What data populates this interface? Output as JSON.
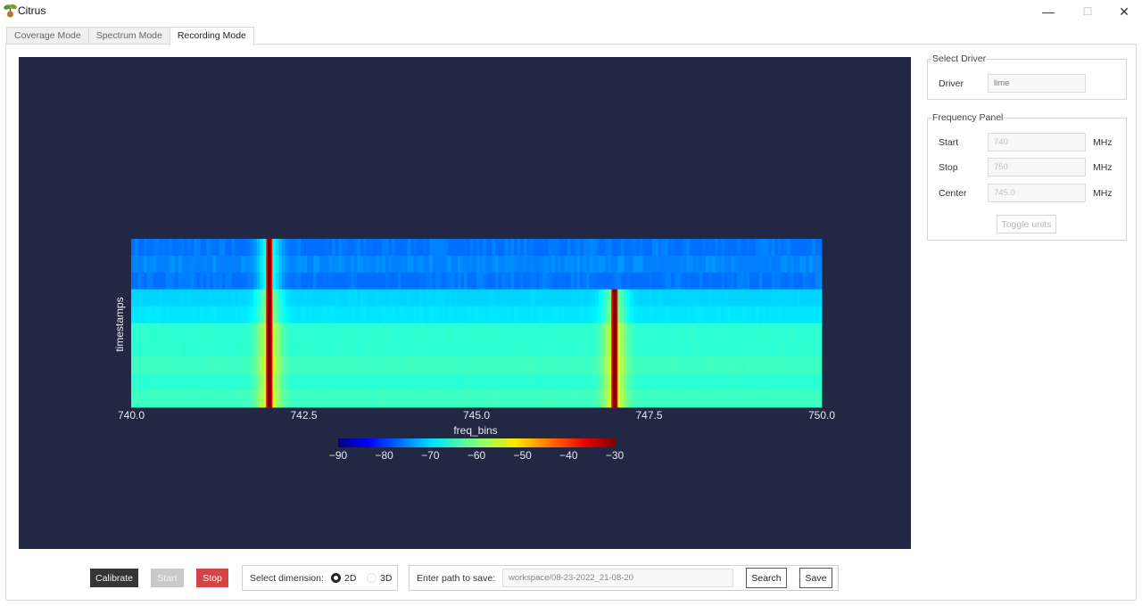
{
  "window": {
    "title": "Citrus",
    "controls": {
      "minimize": "—",
      "maximize": "☐",
      "close": "✕"
    }
  },
  "tabs": [
    {
      "label": "Coverage Mode",
      "active": false
    },
    {
      "label": "Spectrum Mode",
      "active": false
    },
    {
      "label": "Recording Mode",
      "active": true
    }
  ],
  "select_driver": {
    "title": "Select Driver",
    "driver_label": "Driver",
    "driver_value": "lime"
  },
  "frequency_panel": {
    "title": "Frequency Panel",
    "start_label": "Start",
    "start_value": "740",
    "stop_label": "Stop",
    "stop_value": "750",
    "center_label": "Center",
    "center_value": "745.0",
    "unit": "MHz",
    "toggle_units_label": "Toggle units"
  },
  "toolbar": {
    "calibrate_label": "Calibrate",
    "start_label": "Start",
    "stop_label": "Stop",
    "select_dimension_label": "Select dimension:",
    "dimension_options": [
      {
        "label": "2D",
        "selected": true
      },
      {
        "label": "3D",
        "selected": false
      }
    ],
    "path_label": "Enter path to save:",
    "path_value": "workspace/08-23-2022_21-08-20",
    "search_label": "Search",
    "save_label": "Save"
  },
  "colors": {
    "plot_background": "#222844",
    "calibrate_button": "#353535",
    "start_button_disabled": "#c9c9c9",
    "stop_button": "#d24646"
  },
  "chart_data": {
    "type": "heatmap",
    "title": "",
    "xlabel": "freq_bins",
    "ylabel": "timestamps",
    "xlim": [
      740.0,
      750.0
    ],
    "xticks": [
      740.0,
      742.5,
      745.0,
      747.5,
      750.0
    ],
    "xtick_labels": [
      "740.0",
      "742.5",
      "745.0",
      "747.5",
      "750.0"
    ],
    "colorscale": "jet",
    "color_range": [
      -90,
      -30
    ],
    "colorbar_ticks": [
      -90,
      -80,
      -70,
      -60,
      -50,
      -40,
      -30
    ],
    "colorbar_tick_labels": [
      "−90",
      "−80",
      "−70",
      "−60",
      "−50",
      "−40",
      "−30"
    ],
    "rows": 10,
    "row_baseline_db": [
      -76,
      -75,
      -76,
      -70,
      -69,
      -65,
      -65,
      -64,
      -65,
      -64
    ],
    "peaks": [
      {
        "freq_mhz": 742.0,
        "peak_db": -30,
        "rows_active": [
          0,
          1,
          2,
          3,
          4,
          5,
          6,
          7,
          8,
          9
        ]
      },
      {
        "freq_mhz": 747.0,
        "peak_db": -30,
        "rows_active": [
          3,
          4,
          5,
          6,
          7,
          8,
          9
        ]
      }
    ],
    "grid": false
  }
}
